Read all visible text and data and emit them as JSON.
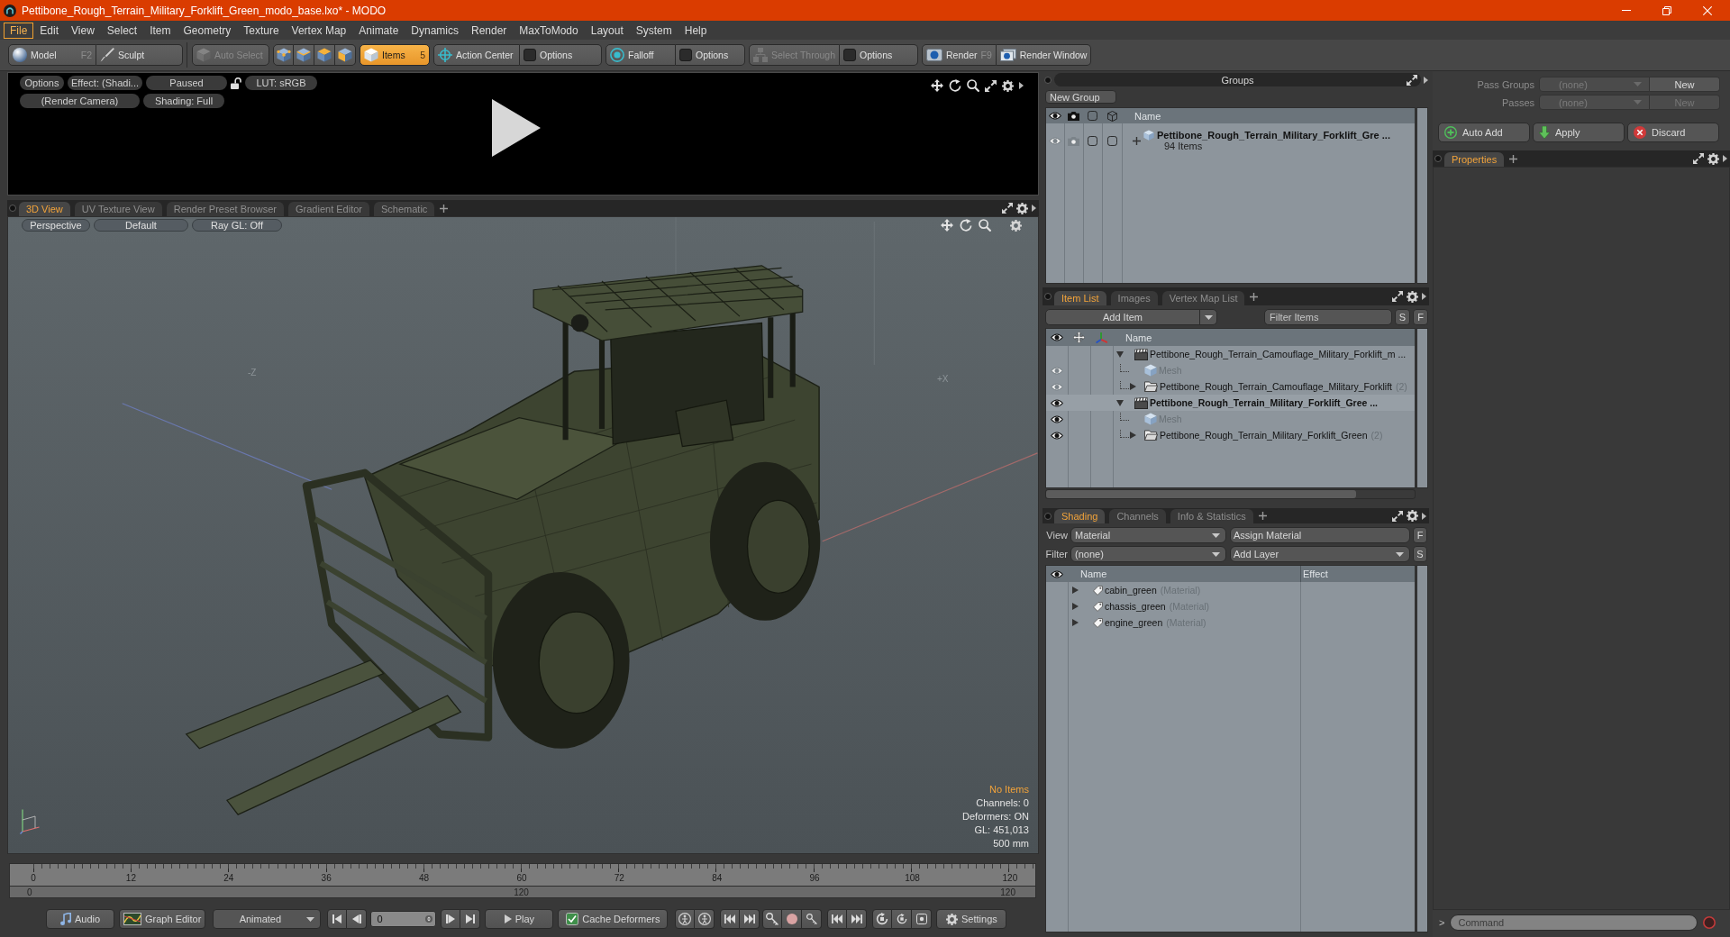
{
  "window": {
    "title": "Pettibone_Rough_Terrain_Military_Forklift_Green_modo_base.lxo* - MODO"
  },
  "menu": [
    {
      "label": "File",
      "selected": true
    },
    {
      "label": "Edit",
      "selected": false
    },
    {
      "label": "View",
      "selected": false
    },
    {
      "label": "Select",
      "selected": false
    },
    {
      "label": "Item",
      "selected": false
    },
    {
      "label": "Geometry",
      "selected": false
    },
    {
      "label": "Texture",
      "selected": false
    },
    {
      "label": "Vertex Map",
      "selected": false
    },
    {
      "label": "Animate",
      "selected": false
    },
    {
      "label": "Dynamics",
      "selected": false
    },
    {
      "label": "Render",
      "selected": false
    },
    {
      "label": "MaxToModo",
      "selected": false
    },
    {
      "label": "Layout",
      "selected": false
    },
    {
      "label": "System",
      "selected": false
    },
    {
      "label": "Help",
      "selected": false
    }
  ],
  "toolbar": [
    {
      "buttons": [
        {
          "label": "Model",
          "shortcut": "F2",
          "selected": false,
          "disabled": false
        },
        {
          "label": "Sculpt",
          "selected": false,
          "disabled": false
        }
      ]
    },
    {
      "buttons": [
        {
          "label": "Auto Select",
          "selected": false,
          "disabled": true
        }
      ]
    },
    {
      "buttons": [
        {
          "selected": false,
          "disabled": false
        },
        {
          "selected": false,
          "disabled": false
        },
        {
          "selected": false,
          "disabled": false
        },
        {
          "selected": false,
          "disabled": false
        }
      ]
    },
    {
      "buttons": [
        {
          "label": "Items",
          "shortcut": "5",
          "selected": true,
          "disabled": false
        }
      ]
    },
    {
      "buttons": [
        {
          "label": "Action Center",
          "selected": false,
          "disabled": false
        },
        {
          "label": "Options",
          "selected": false,
          "disabled": false
        }
      ]
    },
    {
      "buttons": [
        {
          "label": "Falloff",
          "selected": false,
          "disabled": false
        },
        {
          "label": "Options",
          "selected": false,
          "disabled": false
        }
      ]
    },
    {
      "buttons": [
        {
          "label": "Select Through",
          "selected": false,
          "disabled": true
        },
        {
          "label": "Options",
          "selected": false,
          "disabled": false
        }
      ]
    },
    {
      "buttons": [
        {
          "label": "Render",
          "shortcut": "F9",
          "selected": false,
          "disabled": false
        },
        {
          "label": "Render Window",
          "selected": false,
          "disabled": false
        }
      ]
    }
  ],
  "render_preview": {
    "rows": [
      {
        "buttons": [
          "Options",
          "Effect: (Shadi...",
          "Paused",
          "LUT: sRGB"
        ]
      },
      {
        "buttons": [
          "(Render Camera)",
          "Shading: Full"
        ]
      }
    ]
  },
  "viewport": {
    "tabs": [
      {
        "label": "3D View",
        "selected": true
      },
      {
        "label": "UV Texture View",
        "selected": false
      },
      {
        "label": "Render Preset Browser",
        "selected": false
      },
      {
        "label": "Gradient Editor",
        "selected": false
      },
      {
        "label": "Schematic",
        "selected": false
      }
    ],
    "toolbar": [
      "Perspective",
      "Default",
      "Ray GL: Off"
    ],
    "axis_labels": [
      "-Z",
      "+X"
    ],
    "info": [
      {
        "text": "No Items",
        "kind": "alert"
      },
      {
        "text": "Channels: 0",
        "kind": "stat"
      },
      {
        "text": "Deformers: ON",
        "kind": "stat"
      },
      {
        "text": "GL: 451,013",
        "kind": "stat"
      },
      {
        "text": "500 mm",
        "kind": "stat"
      }
    ]
  },
  "timeline": {
    "ticks": [
      "0",
      "12",
      "24",
      "36",
      "48",
      "60",
      "72",
      "84",
      "96",
      "108",
      "120"
    ],
    "range": [
      "0",
      "120",
      "120"
    ]
  },
  "anim_bar": {
    "audio": "Audio",
    "graph_editor": "Graph Editor",
    "mode": "Animated",
    "frame": "0",
    "play": "Play",
    "cache": "Cache Deformers",
    "settings": "Settings"
  },
  "groups": {
    "title": "Groups",
    "new_button": "New Group",
    "name_column": "Name",
    "rows": [
      {
        "name": "Pettibone_Rough_Terrain_Military_Forklift_Gre ...",
        "count": "94 Items",
        "expanded": false
      }
    ]
  },
  "item_list": {
    "tabs": [
      {
        "label": "Item List",
        "selected": true
      },
      {
        "label": "Images",
        "selected": false
      },
      {
        "label": "Vertex Map List",
        "selected": false
      }
    ],
    "add_button": "Add Item",
    "filter_placeholder": "Filter Items",
    "buttons": [
      "S",
      "F"
    ],
    "name_column": "Name",
    "items": [
      {
        "kind": "scene",
        "name": "Pettibone_Rough_Terrain_Camouflage_Military_Forklift_m ...",
        "visible": false,
        "current": false,
        "expanded": true,
        "children": [
          {
            "kind": "mesh",
            "name": "Mesh",
            "visible": true
          },
          {
            "kind": "group",
            "name": "Pettibone_Rough_Terrain_Camouflage_Military_Forklift",
            "count": "(2)",
            "visible": true,
            "expanded": false
          }
        ]
      },
      {
        "kind": "scene",
        "name": "Pettibone_Rough_Terrain_Military_Forklift_Gree ...",
        "visible": true,
        "current": true,
        "expanded": true,
        "children": [
          {
            "kind": "mesh",
            "name": "Mesh",
            "visible": true
          },
          {
            "kind": "group",
            "name": "Pettibone_Rough_Terrain_Military_Forklift_Green",
            "count": "(2)",
            "visible": true,
            "expanded": false
          }
        ]
      }
    ]
  },
  "shading": {
    "tabs": [
      {
        "label": "Shading",
        "selected": true
      },
      {
        "label": "Channels",
        "selected": false
      },
      {
        "label": "Info & Statistics",
        "selected": false
      }
    ],
    "view_label": "View",
    "view_value": "Material",
    "assign_button": "Assign Material",
    "assign_key": "F",
    "filter_label": "Filter",
    "filter_value": "(none)",
    "layer_button": "Add Layer",
    "layer_key": "S",
    "columns": [
      "Name",
      "Effect"
    ],
    "rows": [
      {
        "name": "cabin_green",
        "type": "(Material)",
        "expanded": false
      },
      {
        "name": "chassis_green",
        "type": "(Material)",
        "expanded": false
      },
      {
        "name": "engine_green",
        "type": "(Material)",
        "expanded": false
      }
    ]
  },
  "pass_panel": {
    "rows": [
      {
        "label": "Pass Groups",
        "value": "(none)",
        "button": "New",
        "disabled": false
      },
      {
        "label": "Passes",
        "value": "(none)",
        "button": "New",
        "disabled": true
      }
    ],
    "actions": [
      "Auto Add",
      "Apply",
      "Discard"
    ],
    "tabs": [
      {
        "label": "Properties",
        "selected": true
      }
    ],
    "command_prompt": ">",
    "command_placeholder": "Command"
  }
}
